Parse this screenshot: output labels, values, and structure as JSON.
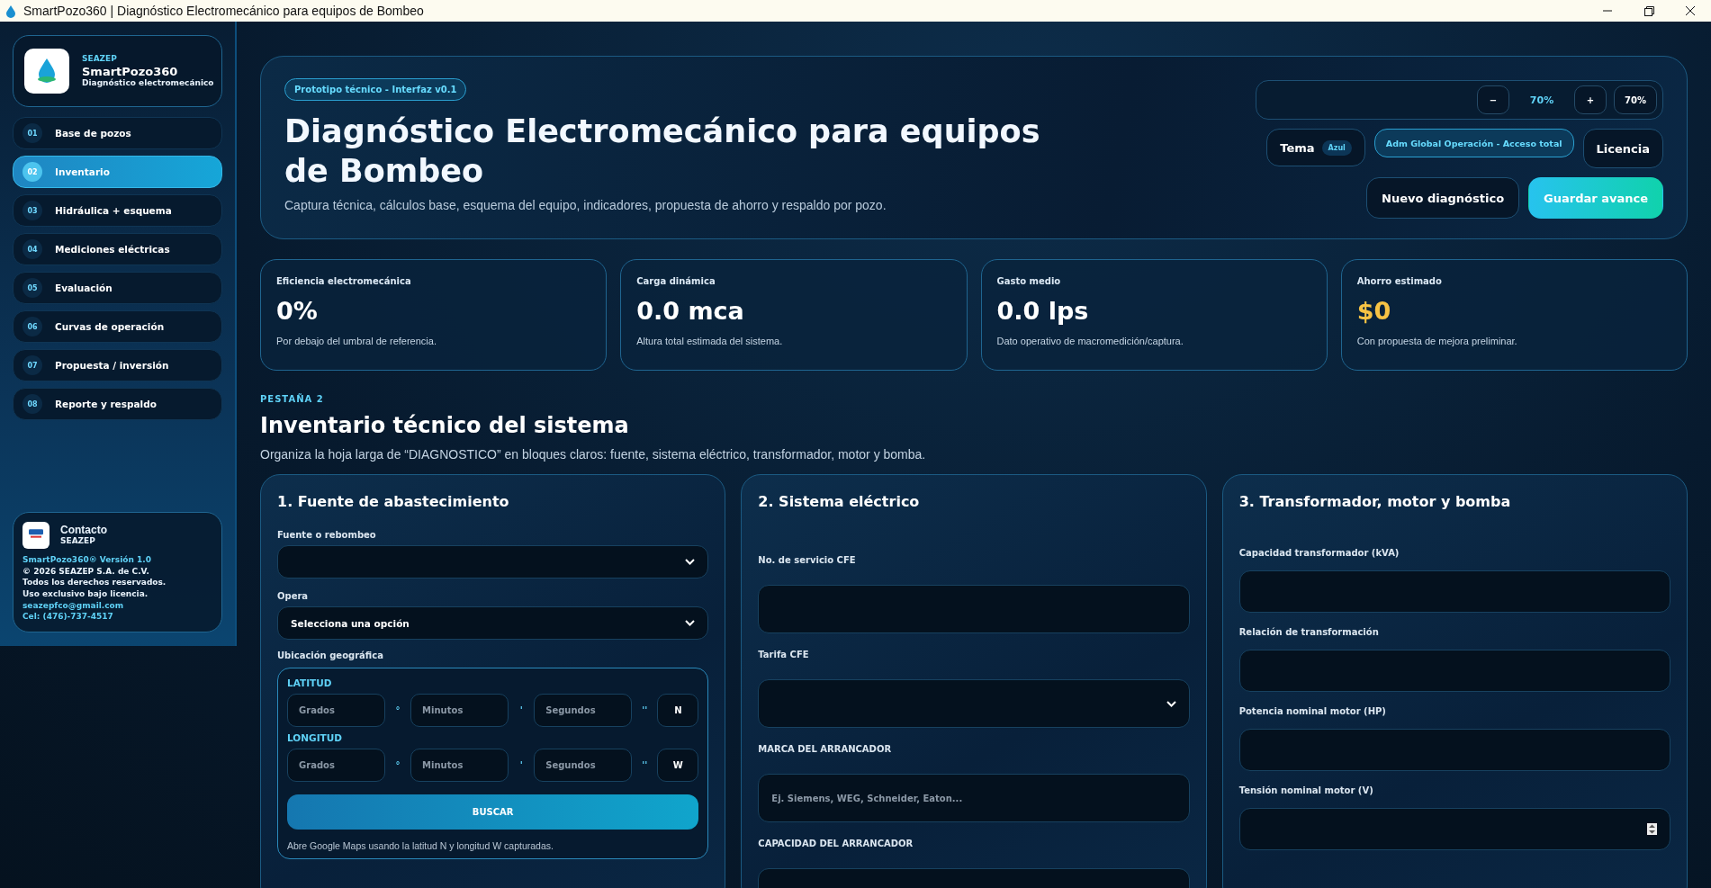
{
  "window": {
    "title": "SmartPozo360 | Diagnóstico Electromecánico para equipos de Bombeo"
  },
  "sidebar": {
    "brand": {
      "company": "SEAZEP",
      "name": "SmartPozo360",
      "tagline": "Diagnóstico electromecánico"
    },
    "items": [
      {
        "number": "01",
        "label": "Base de pozos",
        "selected": false
      },
      {
        "number": "02",
        "label": "Inventario",
        "selected": true
      },
      {
        "number": "03",
        "label": "Hidráulica + esquema",
        "selected": false
      },
      {
        "number": "04",
        "label": "Mediciones eléctricas",
        "selected": false
      },
      {
        "number": "05",
        "label": "Evaluación",
        "selected": false
      },
      {
        "number": "06",
        "label": "Curvas de operación",
        "selected": false
      },
      {
        "number": "07",
        "label": "Propuesta / inversión",
        "selected": false
      },
      {
        "number": "08",
        "label": "Reporte y respaldo",
        "selected": false
      }
    ],
    "contact": {
      "title": "Contacto",
      "company": "SEAZEP",
      "version": "SmartPozo360® Versión 1.0",
      "lines": [
        "© 2026 SEAZEP S.A. de C.V.",
        "Todos los derechos reservados.",
        "Uso exclusivo bajo licencia."
      ],
      "email": "seazepfco@gmail.com",
      "phone": "Cel: (476)-737-4517"
    }
  },
  "header": {
    "badge": "Prototipo técnico - Interfaz v0.1",
    "title": "Diagnóstico Electromecánico para equipos de Bombeo",
    "subtitle": "Captura técnica, cálculos base, esquema del equipo, indicadores, propuesta de ahorro y respaldo por pozo.",
    "zoom": {
      "minus": "−",
      "value": "70%",
      "plus": "+",
      "reset": "70%"
    },
    "theme": {
      "label": "Tema",
      "value": "Azul"
    },
    "role": "Adm Global Operación - Acceso total",
    "license": "Licencia",
    "actions": [
      {
        "label": "Nuevo diagnóstico",
        "kind": "secondary"
      },
      {
        "label": "Guardar avance",
        "kind": "primary"
      }
    ]
  },
  "stats": [
    {
      "label": "Eficiencia electromecánica",
      "value": "0%",
      "note": "Por debajo del umbral de referencia.",
      "color": "#ffffff"
    },
    {
      "label": "Carga dinámica",
      "value": "0.0 mca",
      "note": "Altura total estimada del sistema.",
      "color": "#ffffff"
    },
    {
      "label": "Gasto medio",
      "value": "0.0 lps",
      "note": "Dato operativo de macromedición/captura.",
      "color": "#ffffff"
    },
    {
      "label": "Ahorro estimado",
      "value": "$0",
      "note": "Con propuesta de mejora preliminar.",
      "color": "#f7c344"
    }
  ],
  "section": {
    "eyebrow": "PESTAÑA 2",
    "title": "Inventario técnico del sistema",
    "description": "Organiza la hoja larga de “DIAGNOSTICO” en bloques claros: fuente, sistema eléctrico, transformador, motor y bomba."
  },
  "columns": [
    {
      "title": "1. Fuente de abastecimiento",
      "fields": [
        {
          "kind": "select",
          "label": "Fuente o rebombeo"
        },
        {
          "kind": "select",
          "label": "Opera",
          "value": "Selecciona una opción"
        },
        {
          "kind": "geo",
          "label": "Ubicación geográfica",
          "rows": [
            {
              "label": "LATITUD",
              "parts": [
                {
                  "placeholder": "Grados",
                  "symbol": "°"
                },
                {
                  "placeholder": "Minutos",
                  "symbol": "'"
                },
                {
                  "placeholder": "Segundos",
                  "symbol": "''"
                }
              ],
              "hemisphere": "N"
            },
            {
              "label": "LONGITUD",
              "parts": [
                {
                  "placeholder": "Grados",
                  "symbol": "°"
                },
                {
                  "placeholder": "Minutos",
                  "symbol": "'"
                },
                {
                  "placeholder": "Segundos",
                  "symbol": "''"
                }
              ],
              "hemisphere": "W"
            }
          ],
          "button": "BUSCAR",
          "note": "Abre Google Maps usando la latitud N y longitud W capturadas."
        }
      ]
    },
    {
      "title": "2. Sistema eléctrico",
      "fields": [
        {
          "kind": "text",
          "label": "No. de servicio CFE"
        },
        {
          "kind": "select",
          "label": "Tarifa CFE"
        },
        {
          "kind": "text",
          "label": "MARCA DEL ARRANCADOR",
          "placeholder": "Ej. Siemens, WEG, Schneider, Eaton..."
        },
        {
          "kind": "text",
          "label": "CAPACIDAD DEL ARRANCADOR"
        }
      ]
    },
    {
      "title": "3. Transformador, motor y bomba",
      "fields": [
        {
          "kind": "text",
          "label": "Capacidad transformador (kVA)"
        },
        {
          "kind": "text",
          "label": "Relación de transformación"
        },
        {
          "kind": "text",
          "label": "Potencia nominal motor (HP)"
        },
        {
          "kind": "number",
          "label": "Tensión nominal motor (V)"
        }
      ]
    }
  ]
}
